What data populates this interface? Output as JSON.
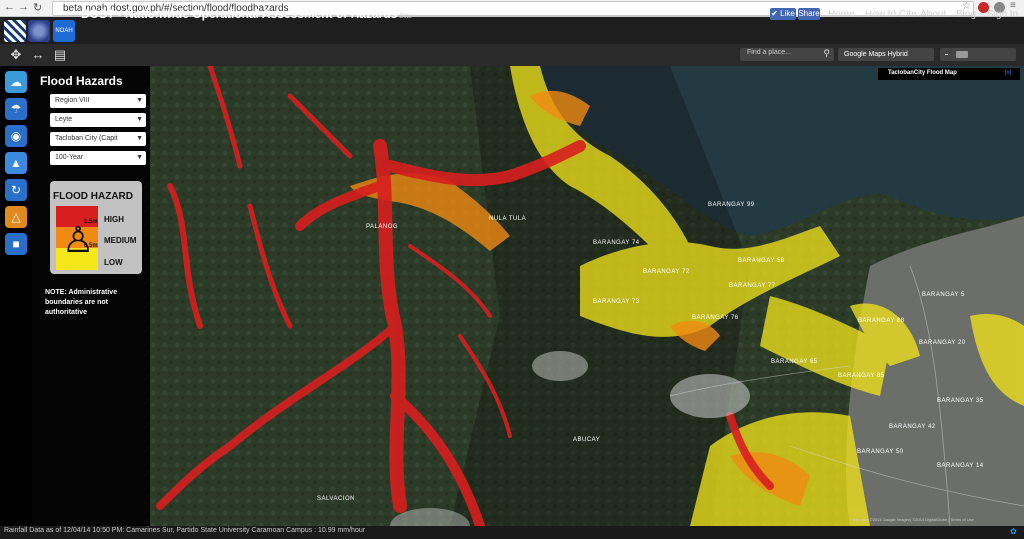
{
  "browser": {
    "url": "beta.noah.dost.gov.ph/#/section/flood/floodhazards",
    "back_icon": "arrow-left",
    "forward_icon": "arrow-right",
    "reload_icon": "reload"
  },
  "header": {
    "title": "DOST - Nationwide Operational Assessment of Hazards",
    "beta": "Beta",
    "like_label": "Like",
    "share_label": "Share",
    "nav": [
      "Home",
      "How to Cite",
      "About",
      "Blog",
      "Sign In"
    ],
    "logos": [
      "dost-logo",
      "project-noah-logo",
      "noah-logo"
    ]
  },
  "toolbar": {
    "search_placeholder": "Find a place...",
    "map_type": "Google Maps Hybrid"
  },
  "panel": {
    "title": "Flood Hazards",
    "region": "Region VIII",
    "province": "Leyte",
    "city": "Tacloban City (Capit",
    "return_period": "100-Year",
    "note": "NOTE: Administrative boundaries are not authoritative"
  },
  "legend": {
    "title": "FLOOD HAZARD",
    "levels": [
      "HIGH",
      "MEDIUM",
      "LOW"
    ],
    "depths": [
      "1.5m",
      "0.5m"
    ],
    "colors": {
      "high": "#d71f1f",
      "medium": "#f08a12",
      "low": "#f5e71a"
    }
  },
  "map": {
    "layer_title": "TaclobanCity Flood Map",
    "labels": [
      "NULA TULA",
      "BARANGAY 99",
      "BARANGAY 74",
      "BARANGAY 72",
      "BARANGAY 58",
      "BARANGAY 77",
      "BARANGAY 73",
      "BARANGAY 76",
      "BARANGAY 65",
      "BARANGAY 85",
      "BARANGAY 88",
      "ABUCAY",
      "SALVACION",
      "PALANOG",
      "BARANGAY 5",
      "BARANGAY 20",
      "BARANGAY 35",
      "BARANGAY 42",
      "BARANGAY 50",
      "BARANGAY 14"
    ],
    "attribution": "Map data ©2014 Google Imagery ©2014 DigitalGlobe | Terms of Use"
  },
  "status": {
    "text": "Rainfall Data as of 12/04/14 10:50 PM: Camarines Sur, Partido State University Caramoan Campus : 10.99 mm/hour"
  }
}
